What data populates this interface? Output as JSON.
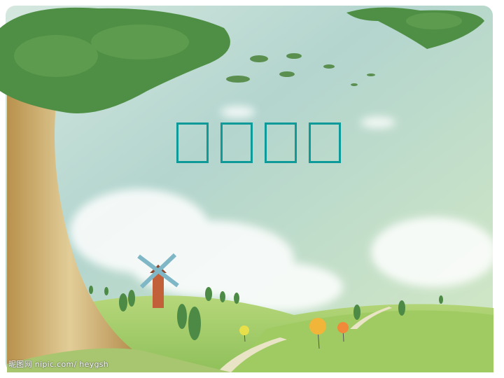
{
  "slide": {
    "title_chars": [
      "□",
      "□",
      "□",
      "□"
    ],
    "watermark": "昵图网 nipic.com/ heygsh"
  },
  "colors": {
    "title": "#0e9a98",
    "sky": "#b4d6cf",
    "grass": "#a6cf6a",
    "leaves": "#4f8f45",
    "trunk": "#c9a86a"
  }
}
